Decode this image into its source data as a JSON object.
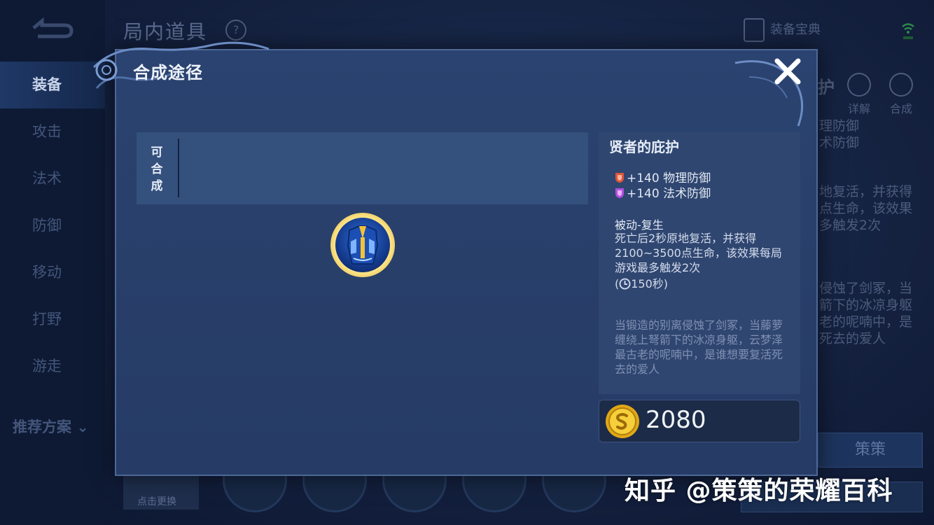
{
  "background": {
    "page_title": "局内道具",
    "help_icon": "?",
    "codex_label": "装备宝典",
    "tabs": [
      {
        "label": "装备",
        "active": true
      },
      {
        "label": "攻击",
        "active": false
      },
      {
        "label": "法术",
        "active": false
      },
      {
        "label": "防御",
        "active": false
      },
      {
        "label": "移动",
        "active": false
      },
      {
        "label": "打野",
        "active": false
      },
      {
        "label": "游走",
        "active": false
      }
    ],
    "recommend_label": "推荐方案",
    "item_heading_fragment": "护",
    "detail_label": "详解",
    "synthesize_label": "合成",
    "right_stats": [
      "理防御",
      "术防御"
    ],
    "right_passive": [
      "地复活，并获得",
      "点生命，该效果",
      "多触发2次"
    ],
    "right_lore": [
      "侵蚀了剑冢，当",
      "箭下的冰凉身躯",
      "老的呢喃中，是",
      "死去的爱人"
    ],
    "bottom_button": "策策",
    "hero_button": "点击更换"
  },
  "modal": {
    "title": "合成途径",
    "close_icon": "close-icon",
    "synth_label": "可合成",
    "item": {
      "name": "贤者的庇护",
      "stats": [
        {
          "text": "+140 物理防御",
          "icon": "physical-shield-icon",
          "color": "#e0553a"
        },
        {
          "text": "+140 法术防御",
          "icon": "magic-shield-icon",
          "color": "#b44fe0"
        }
      ],
      "passive_name": "被动-复生",
      "passive_desc": "死亡后2秒原地复活，并获得2100~3500点生命，该效果每局游戏最多触发2次",
      "cooldown_open": "(",
      "cooldown": "150秒)",
      "lore": "当锻造的别离侵蚀了剑冢，当藤萝缠绕上弩箭下的冰凉身躯，云梦泽最古老的呢喃中，是谁想要复活死去的爱人",
      "price": "2080",
      "price_icon": "gold-coin-icon"
    }
  },
  "watermark": "知乎 @策策的荣耀百科",
  "colors": {
    "accent_gold": "#f2c230",
    "panel": "#283f6a",
    "lore_text": "#7f90b3"
  }
}
